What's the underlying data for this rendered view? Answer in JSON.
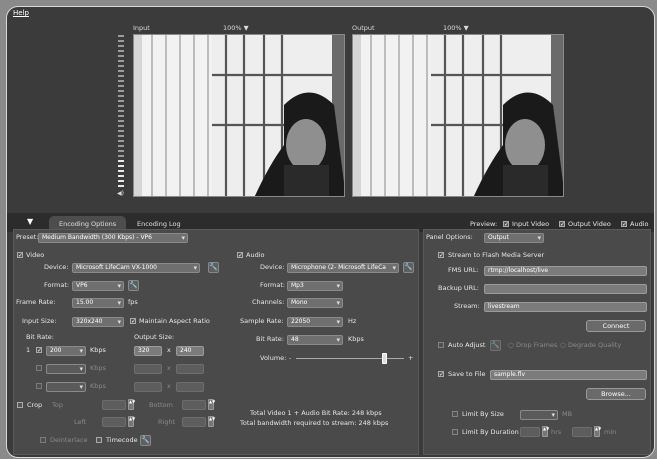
{
  "menu": {
    "help": "Help"
  },
  "input": {
    "label": "Input",
    "zoom": "100% ▼"
  },
  "output": {
    "label": "Output",
    "zoom": "100% ▼"
  },
  "tabs": {
    "encoding_options": "Encoding Options",
    "encoding_log": "Encoding Log"
  },
  "preview": {
    "label": "Preview:",
    "input_video": "Input Video",
    "output_video": "Output Video",
    "audio": "Audio"
  },
  "preset": {
    "label": "Preset:",
    "value": "Medium Bandwidth (300 Kbps) - VP6"
  },
  "panel_options": {
    "label": "Panel Options:",
    "value": "Output"
  },
  "video": {
    "title": "Video",
    "device_label": "Device:",
    "device": "Microsoft LifeCam VX-1000",
    "format_label": "Format:",
    "format": "VP6",
    "frame_rate_label": "Frame Rate:",
    "frame_rate": "15.00",
    "fps": "fps",
    "input_size_label": "Input Size:",
    "input_size": "320x240",
    "maintain_aspect": "Maintain Aspect Ratio",
    "bit_rate_label": "Bit Rate:",
    "output_size_label": "Output Size:",
    "row1_num": "1",
    "bit_rate": "200",
    "kbps": "Kbps",
    "out_w": "320",
    "x": "x",
    "out_h": "240",
    "crop": "Crop",
    "top": "Top",
    "bottom": "Bottom",
    "left": "Left",
    "right": "Right",
    "deinterlace": "Deinterlace",
    "timecode": "Timecode"
  },
  "audio": {
    "title": "Audio",
    "device_label": "Device:",
    "device": "Microphone (2- Microsoft LifeCa",
    "format_label": "Format:",
    "format": "Mp3",
    "channels_label": "Channels:",
    "channels": "Mono",
    "sample_rate_label": "Sample Rate:",
    "sample_rate": "22050",
    "hz": "Hz",
    "bit_rate_label": "Bit Rate:",
    "bit_rate": "48",
    "kbps": "Kbps",
    "volume_label": "Volume:",
    "volume_minus": "-",
    "volume_plus": "+",
    "volume_level": 0.82
  },
  "totals": {
    "line1": "Total Video 1 + Audio Bit Rate:  248 kbps",
    "line2": "Total bandwidth required to stream:  248 kbps"
  },
  "stream": {
    "title": "Stream to Flash Media Server",
    "fms_label": "FMS URL:",
    "fms": "rtmp://localhost/live",
    "backup_label": "Backup URL:",
    "backup": "",
    "stream_label": "Stream:",
    "stream": "livestream",
    "connect": "Connect",
    "auto_adjust": "Auto Adjust",
    "drop_frames": "Drop Frames",
    "degrade_quality": "Degrade Quality"
  },
  "save": {
    "title": "Save to File",
    "file": "sample.flv",
    "browse": "Browse...",
    "limit_size": "Limit By Size",
    "mb": "MB",
    "limit_duration": "Limit By Duration",
    "hrs": "hrs",
    "min": "min"
  }
}
